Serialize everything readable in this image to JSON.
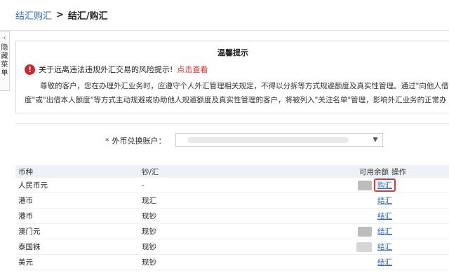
{
  "breadcrumb": {
    "link": "结汇购汇",
    "separator": ">",
    "current": "结汇/购汇"
  },
  "sidebar": {
    "collapse_text": "隐藏菜单"
  },
  "notice": {
    "title": "温馨提示",
    "warning": "关于远离违法违规外汇交易的风险提示!",
    "warning_link": "点击查看",
    "body_line1": "尊敬的客户，您在办理外汇业务时，应遵守个人外汇管理相关规定，不得以分拆等方式规避额度及真实性管理。通过\"向他人借",
    "body_line2": "度\"或\"出借本人额度\"等方式主动规避或协助他人规避额度及真实性管理的客户，将被列入\"关注名单\"管理，影响外汇业务的正常办"
  },
  "account": {
    "label": "外币兑换账户：",
    "required_mark": "*"
  },
  "table": {
    "headers": {
      "currency": "币种",
      "cash_type": "钞/汇",
      "balance": "可用余额",
      "action": "操作"
    },
    "rows": [
      {
        "currency": "人民币元",
        "cash_type": "-",
        "action": "购汇",
        "has_balance": true
      },
      {
        "currency": "港币",
        "cash_type": "现汇",
        "action": "结汇",
        "has_balance": false
      },
      {
        "currency": "港币",
        "cash_type": "现钞",
        "action": "结汇",
        "has_balance": false
      },
      {
        "currency": "澳门元",
        "cash_type": "现钞",
        "action": "结汇",
        "has_balance": true
      },
      {
        "currency": "泰国铢",
        "cash_type": "现钞",
        "action": "结汇",
        "has_balance": true
      },
      {
        "currency": "美元",
        "cash_type": "现钞",
        "action": "结汇",
        "has_balance": false
      }
    ]
  },
  "colors": {
    "link": "#2a6cb8",
    "warning_red": "#c8272c",
    "highlight_red": "#d9363e"
  }
}
